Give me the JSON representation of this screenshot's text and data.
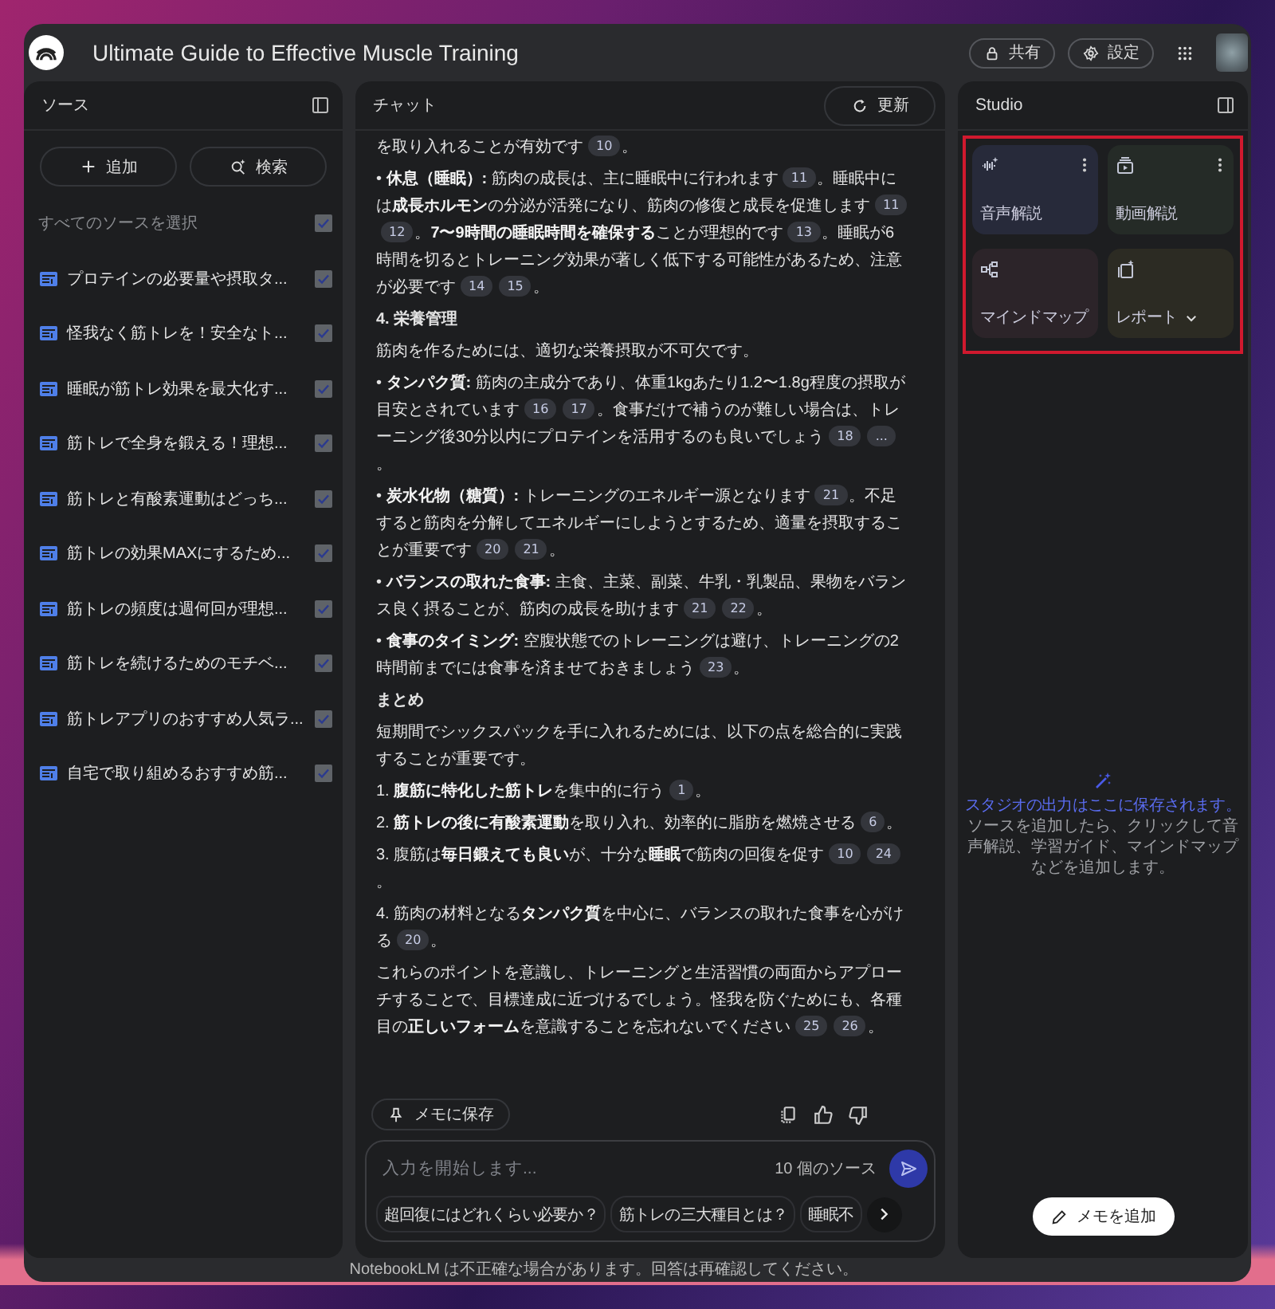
{
  "app": {
    "title": "Ultimate Guide to Effective Muscle Training",
    "share_button": "共有",
    "settings_button": "設定"
  },
  "sources_panel": {
    "title": "ソース",
    "add_button": "追加",
    "search_button": "検索",
    "select_all": {
      "label": "すべてのソースを選択",
      "checked": true
    },
    "items": [
      {
        "title": "プロテインの必要量や摂取タ...",
        "checked": true
      },
      {
        "title": "怪我なく筋トレを！安全なト...",
        "checked": true
      },
      {
        "title": "睡眠が筋トレ効果を最大化す...",
        "checked": true
      },
      {
        "title": "筋トレで全身を鍛える！理想...",
        "checked": true
      },
      {
        "title": "筋トレと有酸素運動はどっち...",
        "checked": true
      },
      {
        "title": "筋トレの効果MAXにするため...",
        "checked": true
      },
      {
        "title": "筋トレの頻度は週何回が理想...",
        "checked": true
      },
      {
        "title": "筋トレを続けるためのモチベ...",
        "checked": true
      },
      {
        "title": "筋トレアプリのおすすめ人気ラ...",
        "checked": true
      },
      {
        "title": "自宅で取り組めるおすすめ筋...",
        "checked": true
      }
    ]
  },
  "chat_panel": {
    "title": "チャット",
    "refresh_button": "更新",
    "messages": [
      {
        "kind": "text",
        "segments": [
          {
            "t": "を取り入れることが有効です"
          },
          {
            "c": "10"
          },
          {
            "t": "。"
          }
        ]
      },
      {
        "kind": "text",
        "segments": [
          {
            "t": "• **休息（睡眠）:** 筋肉の成長は、主に睡眠中に行われます"
          },
          {
            "c": "11"
          },
          {
            "t": "。睡眠中には**成長ホルモン**の分泌が活発になり、筋肉の修復と成長を促進します"
          },
          {
            "c": "11"
          },
          {
            "c": "12"
          },
          {
            "t": "。**7〜9時間の睡眠時間を確保する**ことが理想的です"
          },
          {
            "c": "13"
          },
          {
            "t": "。睡眠が6時間を切るとトレーニング効果が著しく低下する可能性があるため、注意が必要です"
          },
          {
            "c": "14"
          },
          {
            "c": "15"
          },
          {
            "t": "。"
          }
        ]
      },
      {
        "kind": "heading",
        "segments": [
          {
            "t": "4. 栄養管理"
          }
        ]
      },
      {
        "kind": "text",
        "segments": [
          {
            "t": "筋肉を作るためには、適切な栄養摂取が不可欠です。"
          }
        ]
      },
      {
        "kind": "text",
        "segments": [
          {
            "t": "• **タンパク質:** 筋肉の主成分であり、体重1kgあたり1.2〜1.8g程度の摂取が目安とされています"
          },
          {
            "c": "16"
          },
          {
            "c": "17"
          },
          {
            "t": "。食事だけで補うのが難しい場合は、トレーニング後30分以内にプロテインを活用するのも良いでしょう"
          },
          {
            "c": "18"
          },
          {
            "c": "..."
          },
          {
            "t": "。"
          }
        ]
      },
      {
        "kind": "text",
        "segments": [
          {
            "t": "• **炭水化物（糖質）:** トレーニングのエネルギー源となります"
          },
          {
            "c": "21"
          },
          {
            "t": "。不足すると筋肉を分解してエネルギーにしようとするため、適量を摂取することが重要です"
          },
          {
            "c": "20"
          },
          {
            "c": "21"
          },
          {
            "t": "。"
          }
        ]
      },
      {
        "kind": "text",
        "segments": [
          {
            "t": "• **バランスの取れた食事:** 主食、主菜、副菜、牛乳・乳製品、果物をバランス良く摂ることが、筋肉の成長を助けます"
          },
          {
            "c": "21"
          },
          {
            "c": "22"
          },
          {
            "t": "。"
          }
        ]
      },
      {
        "kind": "text",
        "segments": [
          {
            "t": "• **食事のタイミング:** 空腹状態でのトレーニングは避け、トレーニングの2時間前までには食事を済ませておきましょう"
          },
          {
            "c": "23"
          },
          {
            "t": "。"
          }
        ]
      },
      {
        "kind": "heading",
        "segments": [
          {
            "t": "まとめ"
          }
        ]
      },
      {
        "kind": "text",
        "segments": [
          {
            "t": "短期間でシックスパックを手に入れるためには、以下の点を総合的に実践することが重要です。"
          }
        ]
      },
      {
        "kind": "text",
        "segments": [
          {
            "t": "1. **腹筋に特化した筋トレ**を集中的に行う"
          },
          {
            "c": "1"
          },
          {
            "t": "。"
          }
        ]
      },
      {
        "kind": "text",
        "segments": [
          {
            "t": "2. **筋トレの後に有酸素運動**を取り入れ、効率的に脂肪を燃焼させる"
          },
          {
            "c": "6"
          },
          {
            "t": "。"
          }
        ]
      },
      {
        "kind": "text",
        "segments": [
          {
            "t": "3. 腹筋は**毎日鍛えても良い**が、十分な**睡眠**で筋肉の回復を促す"
          },
          {
            "c": "10"
          },
          {
            "c": "24"
          },
          {
            "t": "。"
          }
        ]
      },
      {
        "kind": "text",
        "segments": [
          {
            "t": "4. 筋肉の材料となる**タンパク質**を中心に、バランスの取れた食事を心がける"
          },
          {
            "c": "20"
          },
          {
            "t": "。"
          }
        ]
      },
      {
        "kind": "text",
        "segments": [
          {
            "t": "これらのポイントを意識し、トレーニングと生活習慣の両面からアプローチすることで、目標達成に近づけるでしょう。怪我を防ぐためにも、各種目の**正しいフォーム**を意識することを忘れないでください"
          },
          {
            "c": "25"
          },
          {
            "c": "26"
          },
          {
            "t": "。"
          }
        ]
      }
    ],
    "save_note_button": "メモに保存",
    "input": {
      "placeholder": "入力を開始します...",
      "source_count": "10 個のソース"
    },
    "suggestions": [
      "超回復にはどれくらい必要か？",
      "筋トレの三大種目とは？",
      "睡眠不"
    ]
  },
  "studio_panel": {
    "title": "Studio",
    "tiles": [
      {
        "kind": "audio",
        "label": "音声解説",
        "color": "#272a3a",
        "menu": true,
        "dropdown": false
      },
      {
        "kind": "video",
        "label": "動画解説",
        "color": "#252b27",
        "menu": true,
        "dropdown": false
      },
      {
        "kind": "mindmap",
        "label": "マインドマップ",
        "color": "#2c2429",
        "menu": false,
        "dropdown": false
      },
      {
        "kind": "report",
        "label": "レポート",
        "color": "#2c2b23",
        "menu": false,
        "dropdown": true
      }
    ],
    "empty_title": "スタジオの出力はここに保存されます。",
    "empty_text": "ソースを追加したら、クリックして音声解説、学習ガイド、マインドマップなどを追加します。",
    "add_note_button": "メモを追加"
  },
  "footer": "NotebookLM は不正確な場合があります。回答は再確認してください。"
}
